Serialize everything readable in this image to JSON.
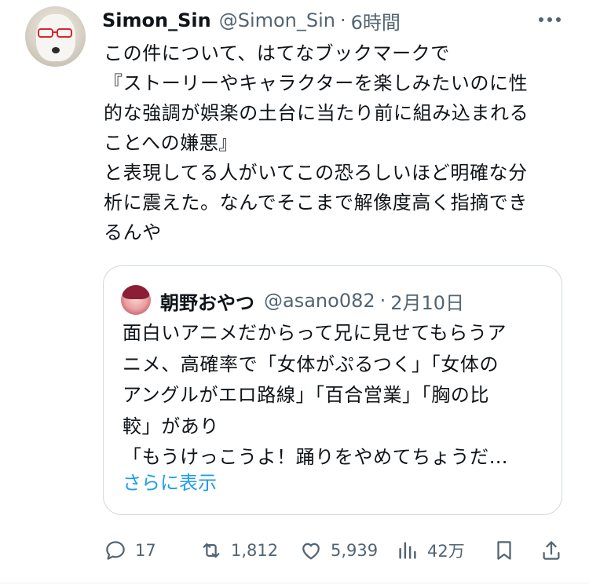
{
  "tweet": {
    "author_name": "Simon_Sin",
    "author_handle": "@Simon_Sin",
    "separator": "·",
    "time": "6時間",
    "text": "この件について、はてなブックマークで\n『ストーリーやキャラクターを楽しみたいのに性\n的な強調が娯楽の土台に当たり前に組み込まれる\nことへの嫌悪』\nと表現してる人がいてこの恐ろしいほど明確な分\n析に震えた。なんでそこまで解像度高く指摘でき\nるんや"
  },
  "quoted_tweet": {
    "author_name": "朝野おやつ",
    "author_handle": "@asano082",
    "separator": "·",
    "date": "2月10日",
    "text": "面白いアニメだからって兄に見せてもらうア\nニメ、高確率で「女体がぷるつく」「女体の\nアングルがエロ路線」「百合営業」「胸の比\n較」があり\n「もうけっこうよ！踊りをやめてちょうだ…",
    "show_more": "さらに表示"
  },
  "actions": {
    "replies": "17",
    "retweets": "1,812",
    "likes": "5,939",
    "views": "42万"
  },
  "icons": {
    "more": "more-horizontal-icon",
    "reply": "reply-icon",
    "retweet": "retweet-icon",
    "like": "heart-icon",
    "views": "views-chart-icon",
    "bookmark": "bookmark-icon",
    "share": "share-icon"
  },
  "colors": {
    "text": "#0f1419",
    "secondary": "#536471",
    "link": "#1d9bf0",
    "border": "#cfd9de"
  }
}
